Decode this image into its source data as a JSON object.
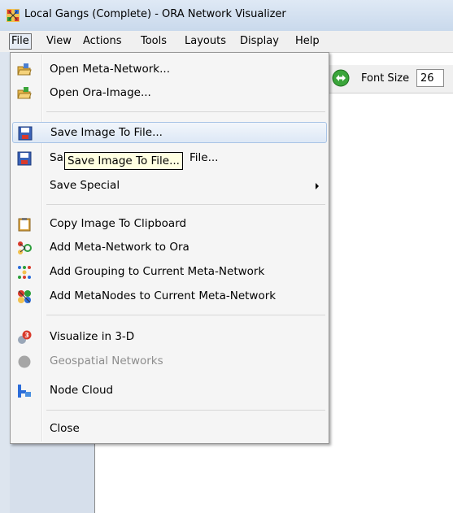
{
  "window": {
    "title": "Local Gangs (Complete) - ORA Network Visualizer"
  },
  "menubar": [
    "File",
    "View",
    "Actions",
    "Tools",
    "Layouts",
    "Display",
    "Help"
  ],
  "toolbar": {
    "font_size_label": "Font Size",
    "font_size_value": "26"
  },
  "file_menu": {
    "open_meta_network": "Open Meta-Network...",
    "open_ora_image": "Open Ora-Image...",
    "save_image_to_file": "Save Image To File...",
    "save_obscured_left": "Sa",
    "save_obscured_right": "File...",
    "save_special": "Save Special",
    "copy_image": "Copy Image To Clipboard",
    "add_meta_network": "Add Meta-Network to Ora",
    "add_grouping": "Add Grouping to Current Meta-Network",
    "add_metanodes": "Add MetaNodes to Current Meta-Network",
    "visualize_3d": "Visualize in 3-D",
    "geospatial": "Geospatial Networks",
    "node_cloud": "Node Cloud",
    "close": "Close"
  },
  "tooltip": "Save Image To File...",
  "colors": {
    "highlight_border": "#a9c4e6",
    "tooltip_bg": "#ffffe1",
    "disabled_text": "#8d8d8d"
  }
}
